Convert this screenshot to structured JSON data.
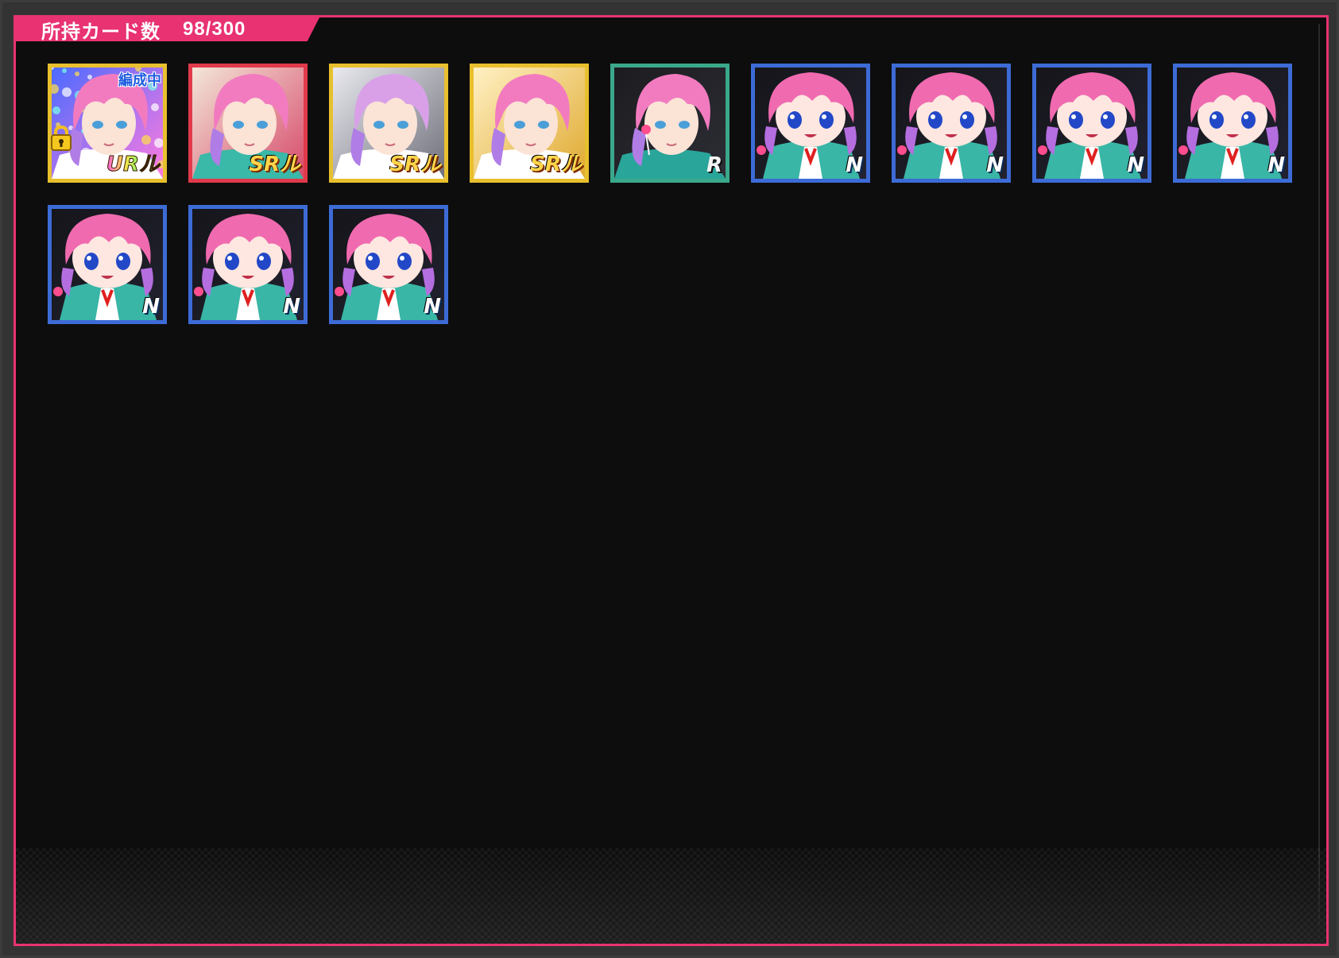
{
  "header": {
    "label": "所持カード数",
    "count": "98/300"
  },
  "colors": {
    "accent": "#e83272",
    "frame_gold": "#e8c02e",
    "frame_red": "#e03a4a",
    "frame_green": "#3aa88a",
    "frame_blue": "#3d6bd6"
  },
  "cards": [
    {
      "rarity": "URル",
      "frame": "ur",
      "badge": "編成中",
      "locked": true,
      "style": "pop"
    },
    {
      "rarity": "SRル",
      "frame": "sr-red",
      "badge": "",
      "locked": false,
      "style": "teal"
    },
    {
      "rarity": "SRル",
      "frame": "ssr",
      "badge": "",
      "locked": false,
      "style": "mono"
    },
    {
      "rarity": "SRル",
      "frame": "ssr",
      "badge": "",
      "locked": false,
      "style": "gold"
    },
    {
      "rarity": "R",
      "frame": "r",
      "badge": "",
      "locked": false,
      "style": "dark"
    },
    {
      "rarity": "N",
      "frame": "n",
      "badge": "",
      "locked": false,
      "style": "chibi"
    },
    {
      "rarity": "N",
      "frame": "n",
      "badge": "",
      "locked": false,
      "style": "chibi"
    },
    {
      "rarity": "N",
      "frame": "n",
      "badge": "",
      "locked": false,
      "style": "chibi"
    },
    {
      "rarity": "N",
      "frame": "n",
      "badge": "",
      "locked": false,
      "style": "chibi"
    },
    {
      "rarity": "N",
      "frame": "n",
      "badge": "",
      "locked": false,
      "style": "chibi"
    },
    {
      "rarity": "N",
      "frame": "n",
      "badge": "",
      "locked": false,
      "style": "chibi"
    },
    {
      "rarity": "N",
      "frame": "n",
      "badge": "",
      "locked": false,
      "style": "chibi"
    }
  ]
}
